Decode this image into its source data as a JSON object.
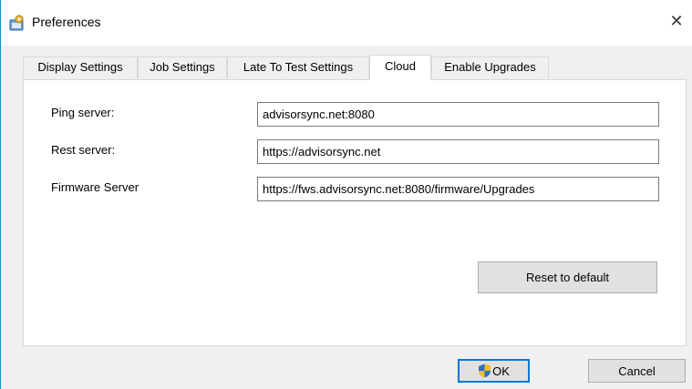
{
  "window": {
    "title": "Preferences",
    "app_icon": "preferences-app-icon",
    "close_glyph": "✕"
  },
  "tabs": [
    {
      "label": "Display Settings",
      "active": false
    },
    {
      "label": "Job Settings",
      "active": false
    },
    {
      "label": "Late To Test Settings",
      "active": false
    },
    {
      "label": "Cloud",
      "active": true
    },
    {
      "label": "Enable Upgrades",
      "active": false
    }
  ],
  "cloud": {
    "ping_server": {
      "label": "Ping server:",
      "value": "advisorsync.net:8080"
    },
    "rest_server": {
      "label": "Rest server:",
      "value": "https://advisorsync.net"
    },
    "firmware_server": {
      "label": "Firmware Server",
      "value": "https://fws.advisorsync.net:8080/firmware/Upgrades"
    },
    "reset_label": "Reset to default"
  },
  "footer": {
    "ok_label": "OK",
    "ok_icon": "uac-shield-icon",
    "cancel_label": "Cancel"
  },
  "colors": {
    "accent": "#0078d7",
    "window_border": "#1a8ad4",
    "dialog_background": "#f0f0f0"
  }
}
